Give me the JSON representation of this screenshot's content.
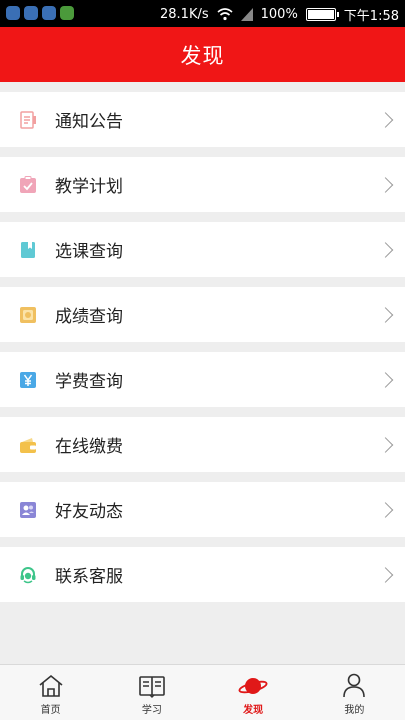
{
  "status_bar": {
    "net_speed": "28.1K/s",
    "battery": "100%",
    "battery_level": 1.0,
    "time": "下午1:58"
  },
  "header": {
    "title": "发现"
  },
  "menu": {
    "items": [
      {
        "label": "通知公告",
        "icon": "notice-doc-icon",
        "color": "#f2a0a0"
      },
      {
        "label": "教学计划",
        "icon": "clipboard-check-icon",
        "color": "#f0a5b8"
      },
      {
        "label": "选课查询",
        "icon": "book-icon",
        "color": "#5fc9d4"
      },
      {
        "label": "成绩查询",
        "icon": "grade-card-icon",
        "color": "#f0c060"
      },
      {
        "label": "学费查询",
        "icon": "yen-icon",
        "color": "#4aa8e6"
      },
      {
        "label": "在线缴费",
        "icon": "wallet-icon",
        "color": "#f3c14b"
      },
      {
        "label": "好友动态",
        "icon": "friends-icon",
        "color": "#8a86d6"
      },
      {
        "label": "联系客服",
        "icon": "headset-icon",
        "color": "#3ec58a"
      }
    ]
  },
  "tabbar": {
    "tabs": [
      {
        "label": "首页",
        "icon": "home-icon"
      },
      {
        "label": "学习",
        "icon": "open-book-icon"
      },
      {
        "label": "发现",
        "icon": "planet-icon",
        "active": true
      },
      {
        "label": "我的",
        "icon": "person-icon"
      }
    ]
  },
  "colors": {
    "accent": "#f01616",
    "background": "#eeeeee"
  }
}
